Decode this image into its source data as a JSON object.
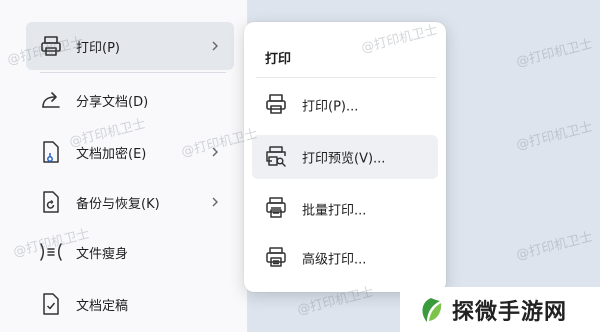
{
  "main_menu": {
    "items": [
      {
        "label": "打印(P)",
        "icon": "printer-icon",
        "has_submenu": true,
        "active": true
      },
      {
        "label": "分享文档(D)",
        "icon": "share-icon",
        "has_submenu": false
      },
      {
        "label": "文档加密(E)",
        "icon": "encrypt-document-icon",
        "has_submenu": true
      },
      {
        "label": "备份与恢复(K)",
        "icon": "backup-restore-icon",
        "has_submenu": true
      },
      {
        "label": "文件瘦身",
        "icon": "slim-file-icon",
        "has_submenu": false
      },
      {
        "label": "文档定稿",
        "icon": "finalize-document-icon",
        "has_submenu": false
      }
    ]
  },
  "submenu": {
    "title": "打印",
    "items": [
      {
        "label": "打印(P)...",
        "icon": "printer-icon"
      },
      {
        "label": "打印预览(V)...",
        "icon": "print-preview-icon",
        "hover": true
      },
      {
        "label": "批量打印...",
        "icon": "batch-print-icon"
      },
      {
        "label": "高级打印...",
        "icon": "advanced-print-icon"
      }
    ]
  },
  "watermark": {
    "text": "@打印机卫士"
  },
  "logo": {
    "text": "探微手游网"
  },
  "colors": {
    "accent_green": "#3a9b3c",
    "active_bg": "#e4e7ec",
    "hover_bg": "#eef0f3"
  }
}
